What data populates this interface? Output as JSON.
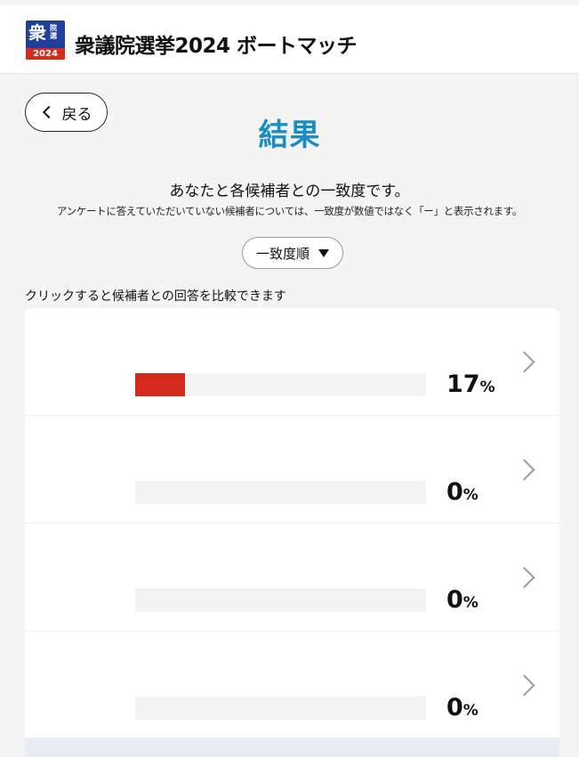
{
  "header": {
    "logo": {
      "main": "衆",
      "sub": "院選",
      "year": "2024"
    },
    "title": "衆議院選挙2024 ボートマッチ"
  },
  "nav": {
    "back_label": "戻る"
  },
  "page": {
    "title": "結果",
    "lead": "あなたと各候補者との一致度です。",
    "note": "アンケートに答えていただいていない候補者については、一致度が数値ではなく「ー」と表示されます。"
  },
  "sort": {
    "selected": "一致度順"
  },
  "list": {
    "hint": "クリックすると候補者との回答を比較できます",
    "colors": {
      "bar": "#d42a20",
      "track": "#f3f3f3"
    },
    "rows": [
      {
        "percent_value": "17",
        "percent_symbol": "%",
        "match": 0.17
      },
      {
        "percent_value": "0",
        "percent_symbol": "%",
        "match": 0
      },
      {
        "percent_value": "0",
        "percent_symbol": "%",
        "match": 0
      },
      {
        "percent_value": "0",
        "percent_symbol": "%",
        "match": 0
      }
    ]
  },
  "icons": {
    "back": "chevron-left-icon",
    "sort": "caret-down-icon",
    "row": "chevron-right-icon"
  }
}
